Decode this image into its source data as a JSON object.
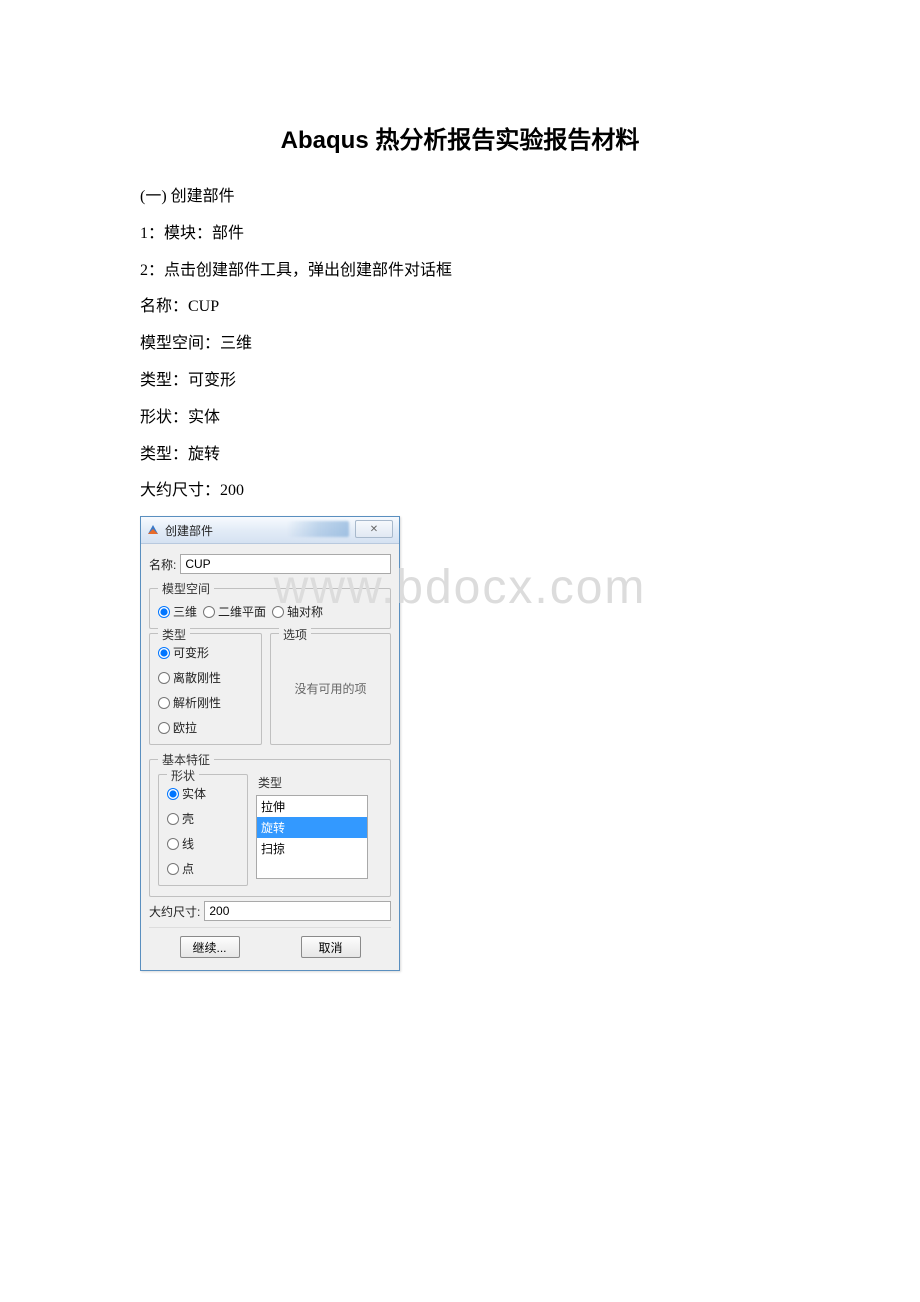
{
  "watermark": "www.bdocx.com",
  "doc": {
    "title": "Abaqus 热分析报告实验报告材料",
    "lines": [
      "(一) 创建部件",
      "1：模块：部件",
      "2：点击创建部件工具，弹出创建部件对话框",
      "名称：CUP",
      "模型空间：三维",
      "类型：可变形",
      "形状：实体",
      "类型：旋转",
      "大约尺寸：200"
    ]
  },
  "dialog": {
    "title": "创建部件",
    "close_glyph": "✕",
    "name_label": "名称:",
    "name_value": "CUP",
    "model_space": {
      "legend": "模型空间",
      "options": [
        "三维",
        "二维平面",
        "轴对称"
      ],
      "selected": "三维"
    },
    "type_group": {
      "legend": "类型",
      "options": [
        "可变形",
        "离散刚性",
        "解析刚性",
        "欧拉"
      ],
      "selected": "可变形"
    },
    "options_group": {
      "legend": "选项",
      "text": "没有可用的项"
    },
    "base_feature": {
      "legend": "基本特征",
      "shape": {
        "legend": "形状",
        "options": [
          "实体",
          "壳",
          "线",
          "点"
        ],
        "selected": "实体"
      },
      "type_list": {
        "legend": "类型",
        "options": [
          "拉伸",
          "旋转",
          "扫掠"
        ],
        "selected": "旋转"
      }
    },
    "approx_size_label": "大约尺寸:",
    "approx_size_value": "200",
    "continue_label": "继续...",
    "cancel_label": "取消"
  }
}
